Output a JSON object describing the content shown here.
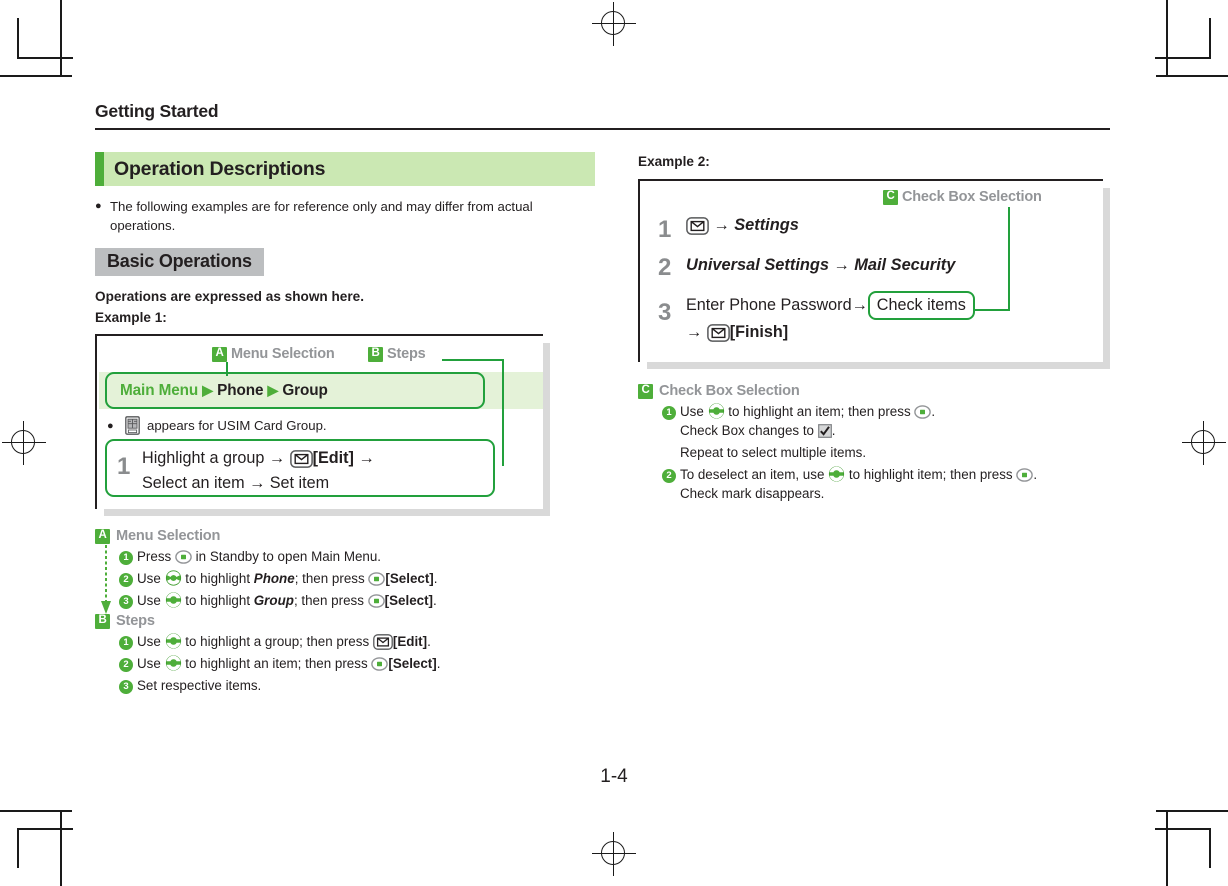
{
  "header": {
    "running_head": "Getting Started"
  },
  "left_column": {
    "section_title": "Operation Descriptions",
    "section_accent_color": "#4eae3a",
    "section_bg_color": "#cbe8b3",
    "note_bullet": "The following examples are for reference only and may differ from actual operations.",
    "sub_head": "Basic Operations",
    "lead_line": "Operations are expressed as shown here.",
    "example_label": "Example 1:",
    "diagram": {
      "callout_a": {
        "badge": "A",
        "label": "Menu Selection"
      },
      "callout_b": {
        "badge": "B",
        "label": "Steps"
      },
      "nav_path": {
        "root": "Main Menu",
        "separator": "▶",
        "item1": "Phone",
        "item2": "Group"
      },
      "note_bullet": "appears for USIM Card Group.",
      "note_icon": "usim-card-icon",
      "step": {
        "number": "1",
        "line1_a": "Highlight a group",
        "arrow": "→",
        "line1_key": "mail-key-icon",
        "line1_b": "[Edit]",
        "line2": "Select an item → Set item"
      }
    },
    "explanations": [
      {
        "badge": "A",
        "title": "Menu Selection",
        "items": [
          {
            "num": "1",
            "pre": "Press ",
            "icon": "center-key-icon",
            "post": " in Standby to open Main Menu."
          },
          {
            "num": "2",
            "pre": "Use ",
            "icon": "four-way-key-icon",
            "mid": " to highlight ",
            "emph": "Phone",
            "mid2": "; then press ",
            "icon2": "center-key-icon",
            "bold_tail": "[Select]",
            "post": "."
          },
          {
            "num": "3",
            "pre": "Use ",
            "icon": "up-down-key-icon",
            "mid": " to highlight ",
            "emph": "Group",
            "mid2": "; then press ",
            "icon2": "center-key-icon",
            "bold_tail": "[Select]",
            "post": "."
          }
        ]
      },
      {
        "badge": "B",
        "title": "Steps",
        "items": [
          {
            "num": "1",
            "pre": "Use ",
            "icon": "up-down-key-icon",
            "mid": " to highlight a group; then press ",
            "icon2": "mail-key-icon",
            "bold_tail": "[Edit]",
            "post": "."
          },
          {
            "num": "2",
            "pre": "Use ",
            "icon": "up-down-key-icon",
            "mid": " to highlight an item; then press ",
            "icon2": "center-key-icon",
            "bold_tail": "[Select]",
            "post": "."
          },
          {
            "num": "3",
            "pre": "Set respective items.",
            "icon": "",
            "mid": "",
            "post": ""
          }
        ]
      }
    ]
  },
  "right_column": {
    "example_label": "Example 2:",
    "diagram": {
      "callout_c": {
        "badge": "C",
        "label": "Check Box Selection"
      },
      "steps": [
        {
          "number": "1",
          "key": "mail-key-icon",
          "arrow": "→",
          "text": "Settings"
        },
        {
          "number": "2",
          "text_a": "Universal Settings",
          "arrow": "→",
          "text_b": "Mail Security"
        },
        {
          "number": "3",
          "line1_a": "Enter Phone Password",
          "arrow": "→",
          "boxed": "Check items",
          "line2_arrow": "→",
          "line2_key": "mail-key-icon",
          "line2_b": "[Finish]"
        }
      ]
    },
    "explanation": {
      "badge": "C",
      "title": "Check Box Selection",
      "items": [
        {
          "num": "1",
          "pre": "Use ",
          "icon": "up-down-key-icon",
          "mid": " to highlight an item; then press ",
          "icon2": "center-key-icon",
          "post": ".",
          "sub_lines": [
            {
              "pre": "Check Box changes to ",
              "icon": "checkbox-checked-icon",
              "post": "."
            },
            {
              "pre": "Repeat to select multiple items.",
              "icon": "",
              "post": ""
            }
          ]
        },
        {
          "num": "2",
          "pre": "To deselect an item, use ",
          "icon": "up-down-key-icon",
          "mid": " to highlight item; then press ",
          "icon2": "center-key-icon",
          "post": ".",
          "sub_lines": [
            {
              "pre": "Check mark disappears.",
              "icon": "",
              "post": ""
            }
          ]
        }
      ]
    }
  },
  "footer": {
    "page_number": "1-4"
  },
  "colors": {
    "green_accent": "#4eae3a",
    "green_line": "#22a03c",
    "green_pale": "#cbe8b3",
    "green_band": "#e4f2d8",
    "gray_label": "#939598",
    "gray_subhead_bg": "#bcbec0",
    "shadow": "#d9d9d9",
    "ink": "#231f20"
  }
}
